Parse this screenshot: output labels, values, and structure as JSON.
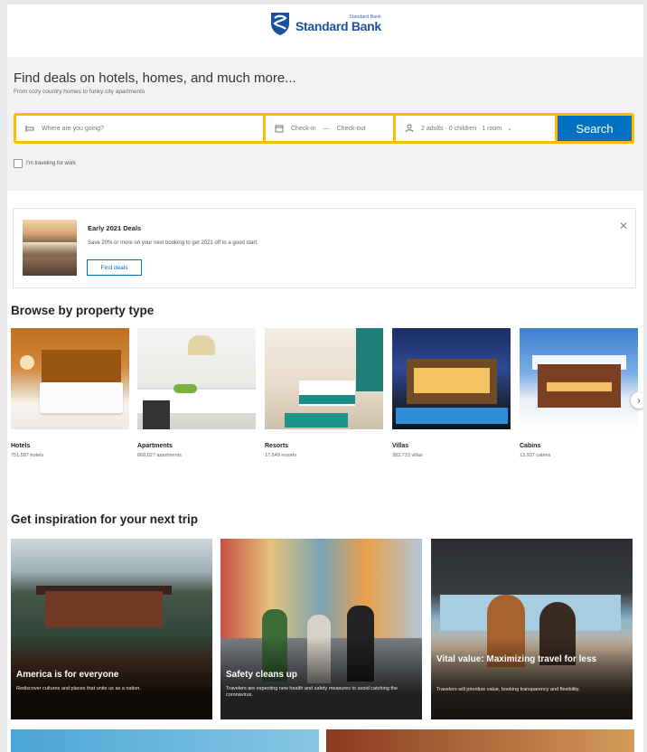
{
  "brand": {
    "name": "Standard Bank",
    "tagline": "Standard Bank"
  },
  "hero": {
    "title": "Find deals on hotels, homes, and much more...",
    "subtitle": "From cozy country homes to funky city apartments"
  },
  "search": {
    "destination_placeholder": "Where are you going?",
    "checkin_label": "Check-in",
    "checkout_label": "Check-out",
    "dates_separator": "—",
    "guests_value": "2 adults · 0 children · 1 room",
    "button_label": "Search",
    "work_travel_label": "I'm traveling for work"
  },
  "promo": {
    "title": "Early 2021 Deals",
    "text": "Save 20% or more on your next booking to get 2021 off to a good start.",
    "button_label": "Find deals",
    "close_icon": "close-icon"
  },
  "property_section": {
    "title": "Browse by property type",
    "items": [
      {
        "name": "Hotels",
        "count": "751,587 hotels"
      },
      {
        "name": "Apartments",
        "count": "868,027 apartments"
      },
      {
        "name": "Resorts",
        "count": "17,649 resorts"
      },
      {
        "name": "Villas",
        "count": "382,733 villas"
      },
      {
        "name": "Cabins",
        "count": "13,937 cabins"
      }
    ],
    "next_icon": "chevron-right-icon"
  },
  "inspiration_section": {
    "title": "Get inspiration for your next trip",
    "cards": [
      {
        "title": "America is for everyone",
        "text": "Rediscover cultures and places that unite us as a nation."
      },
      {
        "title": "Safety cleans up",
        "text": "Travelers are expecting new health and safety measures to avoid catching the coronavirus."
      },
      {
        "title": "Vital value: Maximizing travel for less",
        "text": "Travelers will prioritize value, booking transparency and flexibility."
      }
    ]
  },
  "colors": {
    "accent": "#0071c2",
    "search_border": "#febb02",
    "brand_blue": "#1d4fa0"
  }
}
